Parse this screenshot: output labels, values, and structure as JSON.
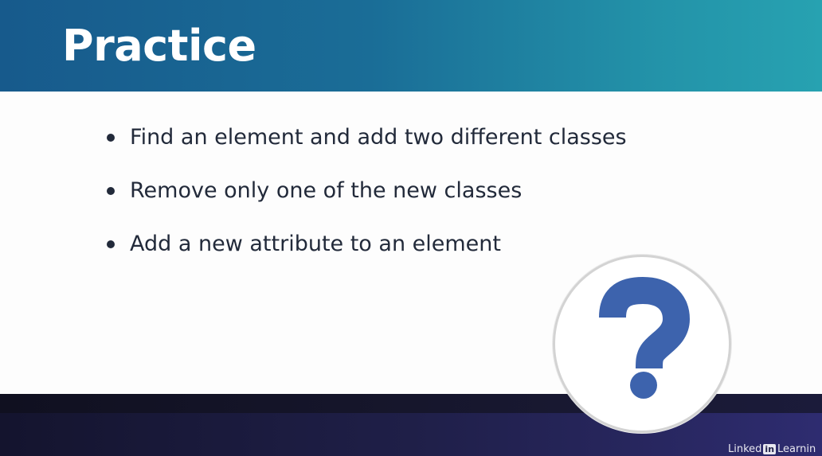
{
  "slide": {
    "title": "Practice",
    "bullets": [
      "Find an element and add two different classes",
      "Remove only one of the new classes",
      "Add a new attribute to an element"
    ]
  },
  "badge": {
    "icon": "question-mark-icon",
    "color": "#3d63ad"
  },
  "brand": {
    "prefix": "Linked",
    "mark": "in",
    "suffix": "Learnin"
  },
  "colors": {
    "header_start": "#175a8c",
    "header_end": "#27a2b1",
    "footer": "#1f1f48",
    "text": "#222a3a"
  }
}
